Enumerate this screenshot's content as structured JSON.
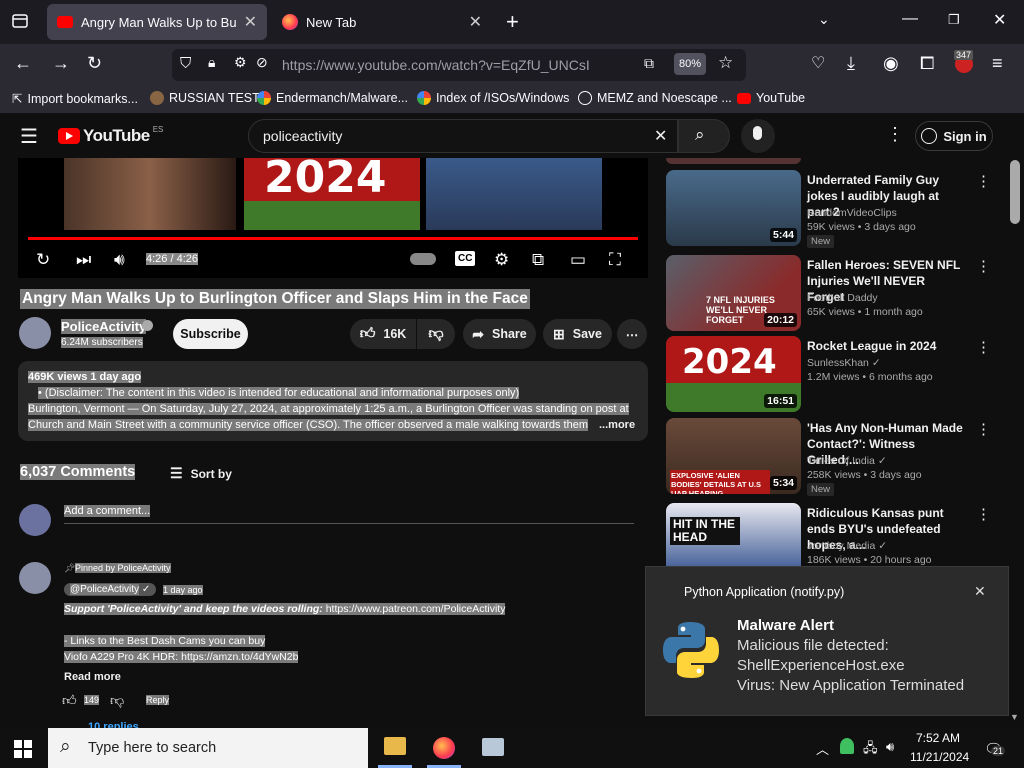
{
  "browser": {
    "tabs": [
      {
        "label": "Angry Man Walks Up to Burling",
        "active": true
      },
      {
        "label": "New Tab",
        "active": false
      }
    ],
    "url": "https://www.youtube.com/watch?v=EqZfU_UNCsI",
    "zoom": "80%",
    "extension_badge": "347",
    "bookmarks": [
      "Import bookmarks...",
      "RUSSIAN TEST",
      "Endermanch/Malware...",
      "Index of /ISOs/Windows",
      "MEMZ and Noescape ...",
      "YouTube"
    ]
  },
  "youtube": {
    "logo": "YouTube",
    "region": "ES",
    "search_value": "policeactivity",
    "sign_in": "Sign in"
  },
  "player": {
    "time": "4:26 / 4:26",
    "thumb_text": "2024"
  },
  "video": {
    "title": "Angry Man Walks Up to Burlington Officer and Slaps Him in the Face",
    "channel": "PoliceActivity",
    "subscribers": "6.24M subscribers",
    "subscribe": "Subscribe",
    "likes": "16K",
    "share": "Share",
    "save": "Save",
    "views_date": "469K views  1 day ago",
    "disclaimer": "(Disclaimer: The content in this video is intended for educational and informational purposes only)",
    "desc_line1": "Burlington, Vermont — On Saturday, July 27, 2024, at approximately 1:25 a.m., a Burlington Officer was standing on post at",
    "desc_line2": "Church and Main Street with a community service officer (CSO). The officer observed a male walking towards them",
    "more": "...more"
  },
  "comments": {
    "count": "6,037 Comments",
    "sort_by": "Sort by",
    "add_placeholder": "Add a comment...",
    "pinned": "Pinned by PoliceActivity",
    "author": "@PoliceActivity",
    "date": "1 day ago",
    "line1_italic": "Support 'PoliceActivity' and keep the videos rolling:",
    "line1_link": " https://www.patreon.com/PoliceActivity",
    "line2": "- Links to the Best Dash Cams you can buy",
    "line3": "Viofo A229 Pro 4K HDR: https://amzn.to/4dYwN2b",
    "read_more": "Read more",
    "likes": "149",
    "reply": "Reply",
    "replies": "10 replies"
  },
  "sidebar": [
    {
      "title": "Underrated Family Guy jokes I audibly laugh at part 2",
      "channel": "RandomVideoClips",
      "meta": "59K views  •  3 days ago",
      "duration": "5:44",
      "new": "New",
      "verified": false,
      "thumb": "#2a4a6a"
    },
    {
      "title": "Fallen Heroes: SEVEN NFL Injuries We'll NEVER Forget",
      "channel": "Football Daddy",
      "meta": "65K views  •  1 month ago",
      "duration": "20:12",
      "new": "",
      "verified": false,
      "thumb": "#3a3f4a",
      "thumb_text": "7 NFL INJURIES WE'LL NEVER FORGET"
    },
    {
      "title": "Rocket League in 2024",
      "channel": "SunlessKhan",
      "meta": "1.2M views  •  6 months ago",
      "duration": "16:51",
      "new": "",
      "verified": true,
      "thumb": "#b01818",
      "thumb_text": "2024"
    },
    {
      "title": "'Has Any Non-Human Made Contact?': Witness Grilled;...",
      "channel": "Times Of India",
      "meta": "258K views  •  3 days ago",
      "duration": "5:34",
      "new": "New",
      "verified": true,
      "thumb": "#5a3a2a",
      "thumb_text": "EXPLOSIVE 'ALIEN BODIES' DETAILS AT U.S UAP HEARING"
    },
    {
      "title": "Ridiculous Kansas punt ends BYU's undefeated hopes, a...",
      "channel": "Jomboy Media",
      "meta": "186K views  •  20 hours ago",
      "duration": "",
      "new": "",
      "verified": true,
      "thumb": "#1e3a6a",
      "thumb_text": "HIT IN THE HEAD"
    }
  ],
  "notification": {
    "app": "Python Application (notify.py)",
    "title": "Malware Alert",
    "line1": "Malicious file detected:",
    "line2": "ShellExperienceHost.exe",
    "line3": "Virus: New Application Terminated"
  },
  "taskbar": {
    "search_placeholder": "Type here to search",
    "time": "7:52 AM",
    "date": "11/21/2024",
    "notifications": "21"
  }
}
